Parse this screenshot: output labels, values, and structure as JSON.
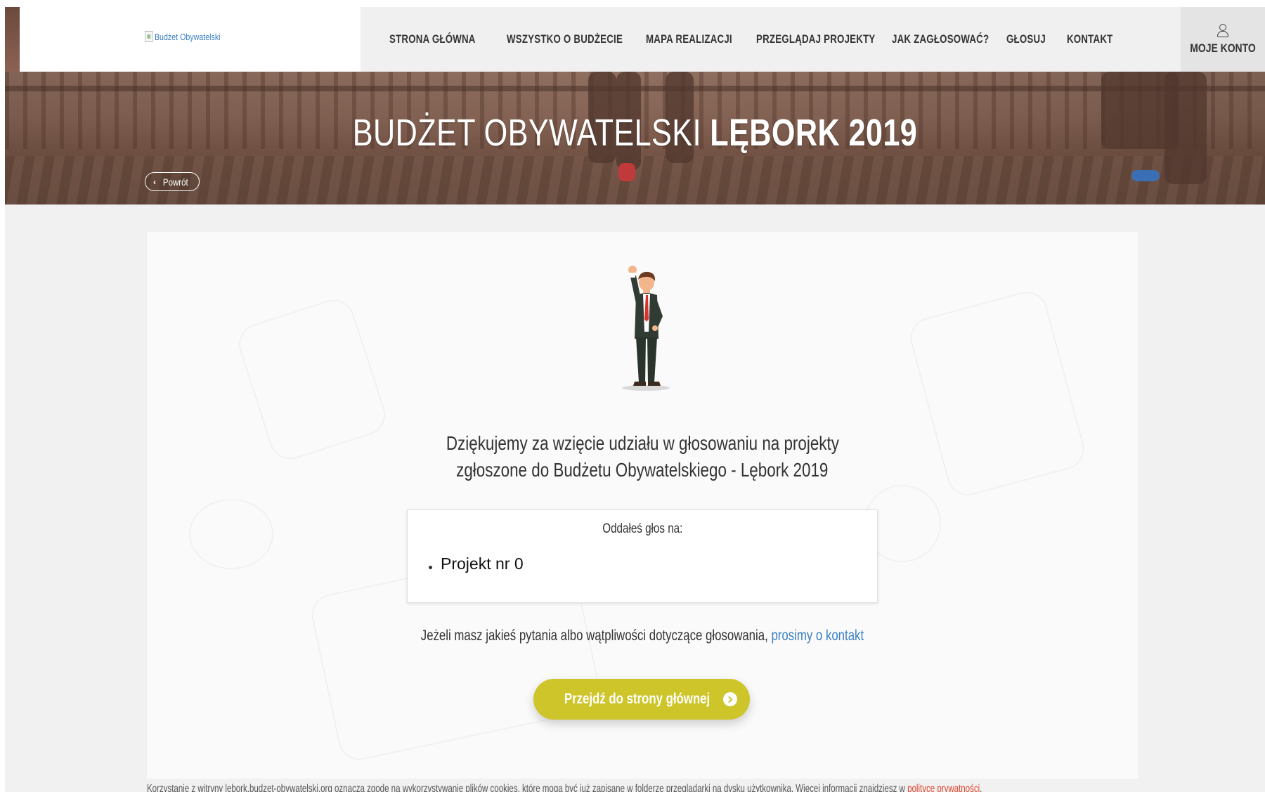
{
  "header": {
    "logo_alt": "Budżet Obywatelski",
    "nav": [
      {
        "label": "STRONA GŁÓWNA"
      },
      {
        "label": "WSZYSTKO O BUDŻECIE"
      },
      {
        "label": "MAPA REALIZACJI"
      },
      {
        "label": "PRZEGLĄDAJ PROJEKTY"
      },
      {
        "label": "JAK ZAGŁOSOWAĆ?"
      },
      {
        "label": "GŁOSUJ"
      },
      {
        "label": "KONTAKT"
      }
    ],
    "account_label": "MOJE KONTO",
    "account_icon": "user-icon"
  },
  "hero": {
    "title_regular": "BUDŻET OBYWATELSKI",
    "title_bold": "LĘBORK 2019",
    "back_label": "Powrót",
    "back_icon": "chevron-left-icon"
  },
  "main": {
    "thanks_line1": "Dziękujemy za wzięcie udziału w głosowaniu na projekty",
    "thanks_line2": "zgłoszone do Budżetu Obywatelskiego - Lębork 2019",
    "vote_header": "Oddałeś głos na:",
    "vote_items": [
      "Projekt nr 0"
    ],
    "contact_text": "Jeżeli masz jakieś pytania albo wątpliwości dotyczące głosowania,",
    "contact_link": "prosimy o kontakt",
    "home_button": "Przejdź do strony głównej",
    "home_button_icon": "arrow-circle-right-icon",
    "accent_color": "#cdc52a",
    "link_color": "#3a7fc1"
  },
  "cookie": {
    "text": "Korzystanie z witryny lebork.budzet-obywatelski.org oznacza zgodę na wykorzystywanie plików cookies, które mogą być już zapisane w folderze przeglądarki na dysku użytkownika. Więcej informacji znajdziesz w",
    "link": "polityce prywatności",
    "suffix": ".",
    "link_color": "#e0462f"
  }
}
